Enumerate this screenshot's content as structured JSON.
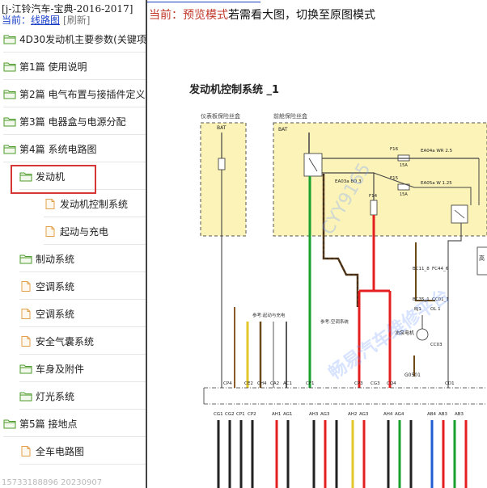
{
  "tree": {
    "header_title": "[j-江铃汽车-宝典-2016-2017]",
    "current_prefix": "当前：",
    "current_link": "线路图",
    "refresh": "[刷新]",
    "items": [
      {
        "label": "4D30发动机主要参数(关键项",
        "icon": "folder-open-icon",
        "indent": 0
      },
      {
        "label": "第1篇 使用说明",
        "icon": "folder-open-icon",
        "indent": 0
      },
      {
        "label": "第2篇 电气布置与接插件定义",
        "icon": "folder-open-icon",
        "indent": 0
      },
      {
        "label": "第3篇 电器盒与电源分配",
        "icon": "folder-open-icon",
        "indent": 0
      },
      {
        "label": "第4篇 系统电路图",
        "icon": "folder-open-icon",
        "indent": 0
      },
      {
        "label": "发动机",
        "icon": "folder-open-icon",
        "indent": 1,
        "selected": true
      },
      {
        "label": "发动机控制系统",
        "icon": "page-icon",
        "indent": 2
      },
      {
        "label": "起动与充电",
        "icon": "page-icon",
        "indent": 2
      },
      {
        "label": "制动系统",
        "icon": "folder-open-icon",
        "indent": 1
      },
      {
        "label": "空调系统",
        "icon": "page-icon",
        "indent": 1
      },
      {
        "label": "空调系统",
        "icon": "page-icon",
        "indent": 1
      },
      {
        "label": "安全气囊系统",
        "icon": "page-icon",
        "indent": 1
      },
      {
        "label": "车身及附件",
        "icon": "folder-open-icon",
        "indent": 1
      },
      {
        "label": "灯光系统",
        "icon": "folder-open-icon",
        "indent": 1
      },
      {
        "label": "第5篇 接地点",
        "icon": "folder-open-icon",
        "indent": 0
      },
      {
        "label": "全车电路图",
        "icon": "page-icon",
        "indent": 1
      }
    ],
    "footer_id": "15733188896 20230907"
  },
  "viewer": {
    "notice_prefix": "当前：",
    "notice_mode": "预览模式",
    "notice_rest": "若需看大图，切换至原图模式",
    "diagram_title": "发动机控制系统 _1",
    "labels": {
      "box_left": "仪表板保险丝盒",
      "box_right": "前舱保险丝盒",
      "bat": "BAT",
      "bat2": "BAT",
      "fuse_main": "EA03a BO 3",
      "fuse_f16": "F16",
      "fuse_f16_amp": "15A",
      "fuse_f15": "F15",
      "fuse_f15_amp": "15A",
      "fuse_f14": "F14",
      "wire_wr": "EA04a WR 2.5",
      "wire_w": "EA05a W 1.25",
      "relay_label": "BC11_8",
      "relay2": "FC44_6",
      "oil_sensor": "油泵电机",
      "cc03": "CC03",
      "g0501": "G0501",
      "ref1": "参考:起动与充电",
      "ref2": "参考:空调系统",
      "gao": "高",
      "bj1": "BJ1",
      "ol1": "OL 1",
      "bc35": "BC35_1",
      "cc01": "CC01_1",
      "watermark1": "CYY9165",
      "watermark2": "畅易汽车维修平台"
    },
    "connectors_row1": [
      "CP4",
      "CE2",
      "CH4",
      "CA2",
      "AC1",
      "CF1",
      "CP3",
      "CG3",
      "CQ4",
      "CD1"
    ],
    "connectors_row2": [
      "CG1",
      "CG2",
      "CP1",
      "CP2",
      "AH1",
      "AG1",
      "AH3",
      "AG3",
      "AH2",
      "AG3",
      "AH4",
      "AG4",
      "AB4",
      "AB3",
      "AB3"
    ]
  }
}
